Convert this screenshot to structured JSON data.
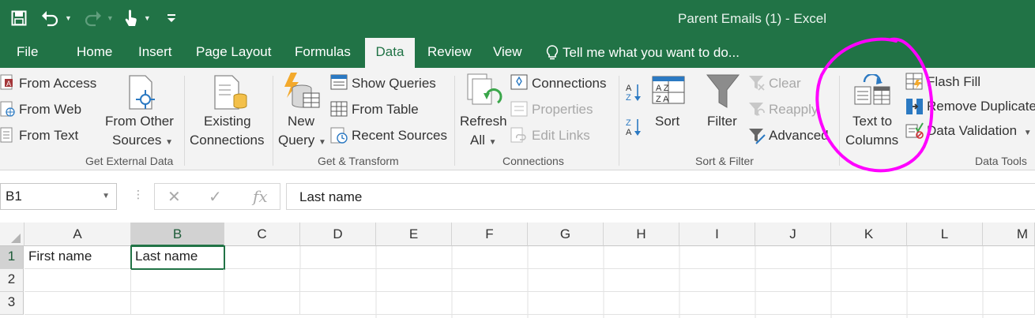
{
  "window": {
    "title": "Parent Emails (1) - Excel"
  },
  "qat": {
    "icons": [
      "save-icon",
      "undo-icon",
      "redo-icon",
      "touch-mode-icon",
      "customize-qat-icon"
    ]
  },
  "tabs": [
    "File",
    "Home",
    "Insert",
    "Page Layout",
    "Formulas",
    "Data",
    "Review",
    "View"
  ],
  "active_tab": "Data",
  "tell_me": "Tell me what you want to do...",
  "ribbon": {
    "get_external_data": {
      "label": "Get External Data",
      "from_access": "From Access",
      "from_web": "From Web",
      "from_text": "From Text",
      "from_other_sources_1": "From Other",
      "from_other_sources_2": "Sources",
      "existing_connections_1": "Existing",
      "existing_connections_2": "Connections"
    },
    "get_transform": {
      "label": "Get & Transform",
      "new_query_1": "New",
      "new_query_2": "Query",
      "show_queries": "Show Queries",
      "from_table": "From Table",
      "recent_sources": "Recent Sources"
    },
    "connections": {
      "label": "Connections",
      "refresh_all_1": "Refresh",
      "refresh_all_2": "All",
      "connections": "Connections",
      "properties": "Properties",
      "edit_links": "Edit Links"
    },
    "sort_filter": {
      "label": "Sort & Filter",
      "sort": "Sort",
      "filter": "Filter",
      "clear": "Clear",
      "reapply": "Reapply",
      "advanced": "Advanced",
      "az": "A Z",
      "za": "Z A"
    },
    "data_tools": {
      "label": "Data Tools",
      "text_to_columns_1": "Text to",
      "text_to_columns_2": "Columns",
      "flash_fill": "Flash Fill",
      "remove_duplicates": "Remove Duplicates",
      "data_validation": "Data Validation"
    }
  },
  "formula_bar": {
    "name_box": "B1",
    "fx": "fx",
    "content": "Last name"
  },
  "grid": {
    "columns": [
      "A",
      "B",
      "C",
      "D",
      "E",
      "F",
      "G",
      "H",
      "I",
      "J",
      "K",
      "L",
      "M"
    ],
    "rows": [
      "1",
      "2",
      "3"
    ],
    "cells": {
      "A1": "First name",
      "B1": "Last name"
    },
    "selected_cell": "B1"
  },
  "colors": {
    "excel_green": "#217346",
    "annotation": "#ff00ff"
  }
}
